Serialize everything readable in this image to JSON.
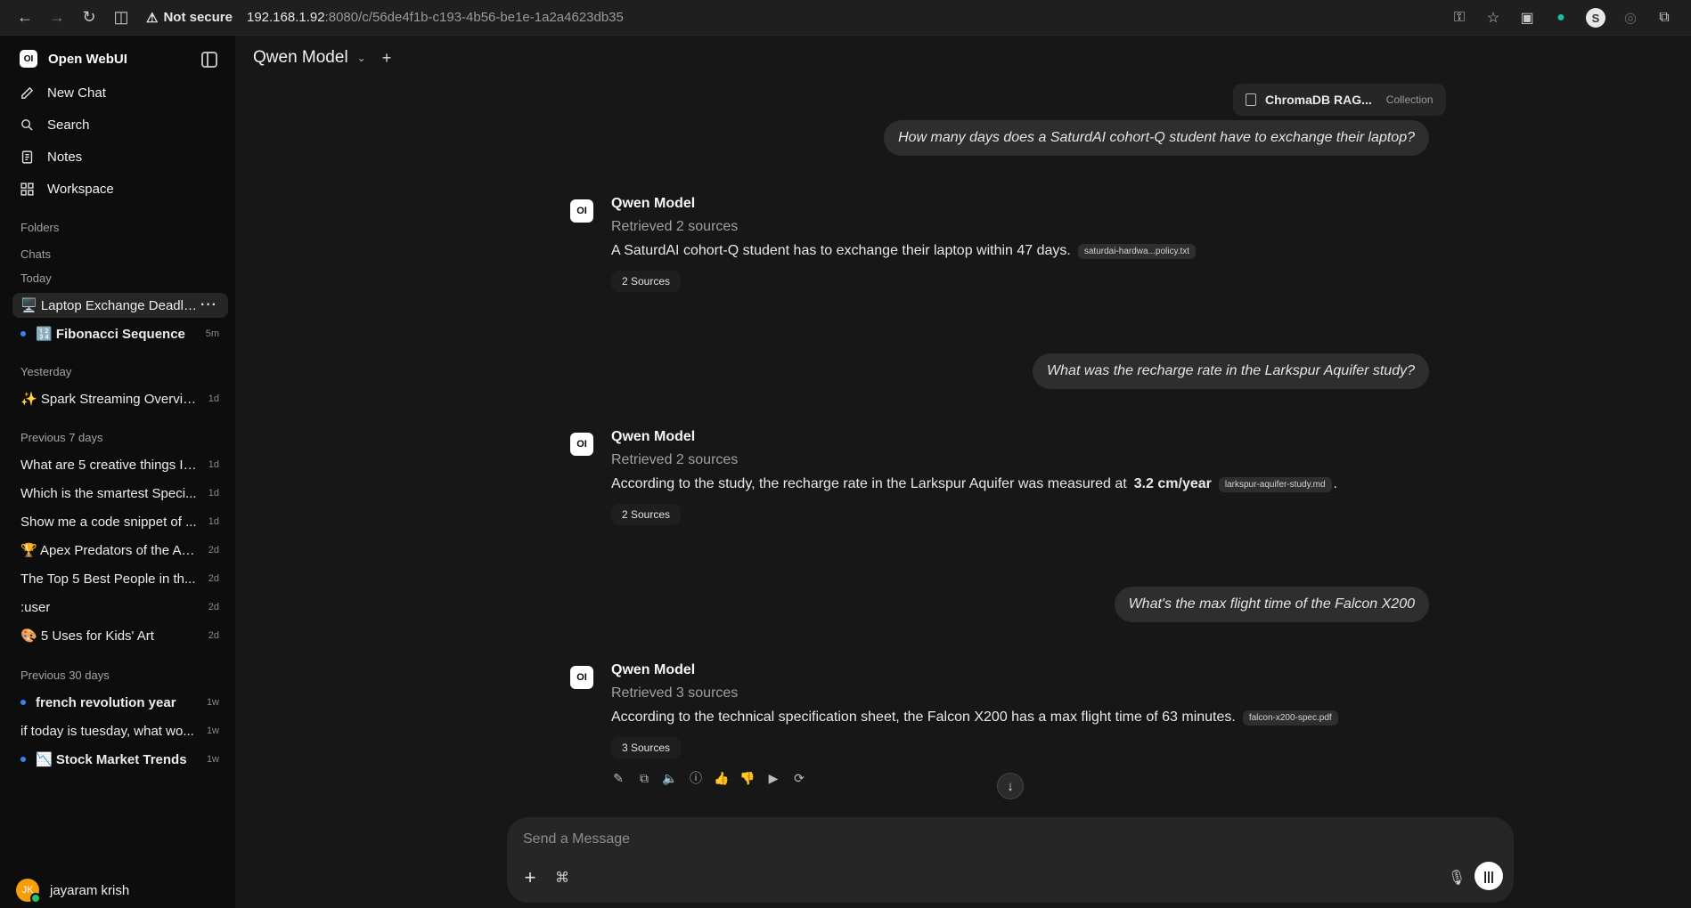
{
  "browser": {
    "secure_label": "Not secure",
    "url_host": "192.168.1.92",
    "url_path": ":8080/c/56de4f1b-c193-4b56-be1e-1a2a4623db35",
    "profile_initial": "S"
  },
  "sidebar": {
    "brand": "Open WebUI",
    "menu": {
      "new_chat": "New Chat",
      "search": "Search",
      "notes": "Notes",
      "workspace": "Workspace"
    },
    "folders_label": "Folders",
    "chats_label": "Chats",
    "today_label": "Today",
    "today": [
      {
        "title": "🖥️ Laptop Exchange Deadline",
        "time": "",
        "active": true
      },
      {
        "title": "🔢 Fibonacci Sequence",
        "time": "5m",
        "unread": true
      }
    ],
    "yesterday_label": "Yesterday",
    "yesterday": [
      {
        "title": "✨ Spark Streaming Overview",
        "time": "1d"
      }
    ],
    "prev7_label": "Previous 7 days",
    "prev7": [
      {
        "title": "What are 5 creative things I ...",
        "time": "1d"
      },
      {
        "title": "Which is the smartest Speci...",
        "time": "1d"
      },
      {
        "title": "Show me a code snippet of ...",
        "time": "1d"
      },
      {
        "title": "🏆 Apex Predators of the An...",
        "time": "2d"
      },
      {
        "title": "The Top 5 Best People in th...",
        "time": "2d"
      },
      {
        "title": ":user",
        "time": "2d"
      },
      {
        "title": "🎨 5 Uses for Kids' Art",
        "time": "2d"
      }
    ],
    "prev30_label": "Previous 30 days",
    "prev30": [
      {
        "title": "french revolution year",
        "time": "1w",
        "unread": true
      },
      {
        "title": "if today is tuesday, what wo...",
        "time": "1w"
      },
      {
        "title": "📉 Stock Market Trends",
        "time": "1w",
        "unread": true
      }
    ],
    "user": {
      "initials": "JK",
      "name": "jayaram krish"
    }
  },
  "main": {
    "model_title": "Qwen Model",
    "collection": {
      "name": "ChromaDB RAG...",
      "type": "Collection"
    },
    "messages": [
      {
        "question": "How many days does a SaturdAI cohort-Q student have to exchange their laptop?",
        "model": "Qwen Model",
        "retrieved": "Retrieved 2 sources",
        "answer": "A SaturdAI cohort-Q student has to exchange their laptop within 47 days.",
        "citation": "saturdai-hardwa...policy.txt",
        "sources": "2 Sources"
      },
      {
        "question": "What was the recharge rate in the Larkspur Aquifer study?",
        "model": "Qwen Model",
        "retrieved": "Retrieved 2 sources",
        "answer_pre": "According to the study, the recharge rate in the Larkspur Aquifer was measured at",
        "answer_bold": "3.2 cm/year",
        "citation": "larkspur-aquifer-study.md",
        "answer_post": ".",
        "sources": "2 Sources"
      },
      {
        "question": "What's the max flight time of the Falcon X200",
        "model": "Qwen Model",
        "retrieved": "Retrieved 3 sources",
        "answer": "According to the technical specification sheet, the Falcon X200 has a max flight time of 63 minutes.",
        "citation": "falcon-x200-spec.pdf",
        "sources": "3 Sources"
      }
    ],
    "composer": {
      "placeholder": "Send a Message"
    }
  }
}
